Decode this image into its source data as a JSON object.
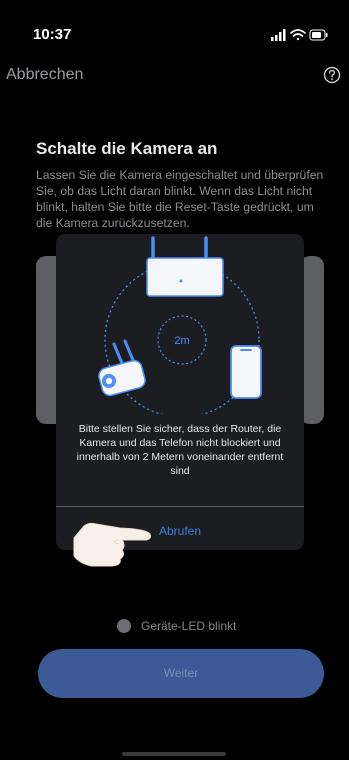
{
  "status_bar": {
    "time": "10:37",
    "icons": [
      "signal-icon",
      "wifi-icon",
      "battery-icon"
    ]
  },
  "nav": {
    "cancel_label": "Abbrechen",
    "help_icon": "help-icon"
  },
  "main": {
    "title": "Schalte die Kamera an",
    "description": "Lassen Sie die Kamera eingeschaltet und überprüfen Sie, ob das Licht daran blinkt. Wenn das Licht nicht blinkt, halten Sie bitte die Reset-Taste gedrückt, um die Kamera zurückzusetzen."
  },
  "modal": {
    "distance_label": "2m",
    "message": "Bitte stellen Sie sicher, dass der Router, die Kamera und das Telefon nicht blockiert und innerhalb von 2 Metern voneinander entfernt sind",
    "action_label": "Abrufen"
  },
  "led": {
    "label": "Geräte-LED blinkt"
  },
  "next_button": {
    "label": "Weiter"
  },
  "colors": {
    "accent": "#3d7fe0",
    "button_bg": "#3c5a95",
    "modal_bg": "#1c1d21",
    "illustration_blue": "#4a8ef5"
  }
}
